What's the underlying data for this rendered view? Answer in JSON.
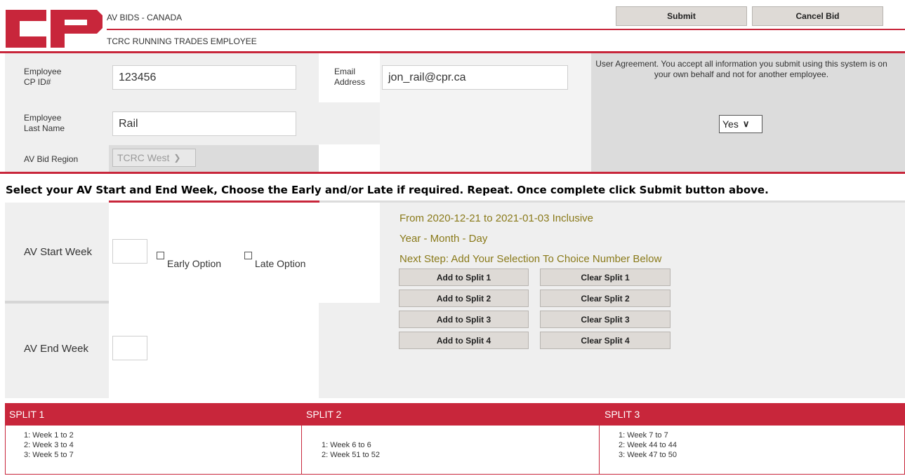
{
  "header": {
    "logo_text": "CP",
    "line1": "AV BIDS - CANADA",
    "line2": "TCRC RUNNING TRADES EMPLOYEE",
    "submit_label": "Submit",
    "cancel_label": "Cancel Bid"
  },
  "form": {
    "employee_id_label_1": "Employee",
    "employee_id_label_2": "CP ID#",
    "employee_id_value": "123456",
    "last_name_label_1": "Employee",
    "last_name_label_2": "Last Name",
    "last_name_value": "Rail",
    "region_label": "AV Bid Region",
    "region_value": "TCRC West",
    "email_label_1": "Email",
    "email_label_2": "Address",
    "email_value": "jon_rail@cpr.ca",
    "agreement_text": "User Agreement. You accept all information you submit using this system is on your own behalf and not for another employee.",
    "agreement_value": "Yes"
  },
  "instruction": "Select your AV Start and End Week, Choose the Early and/or Late if required. Repeat. Once complete click Submit button above.",
  "weeks": {
    "start_label": "AV Start Week",
    "end_label": "AV End Week",
    "early_label": "Early Option",
    "late_label": "Late Option",
    "start_value": "",
    "end_value": ""
  },
  "info": {
    "range": "From 2020-12-21 to 2021-01-03 Inclusive",
    "format": "Year - Month - Day",
    "next_step": "Next Step: Add Your Selection To Choice Number Below"
  },
  "split_buttons": {
    "add": [
      "Add to Split 1",
      "Add to Split 2",
      "Add to Split 3",
      "Add to Split 4"
    ],
    "clear": [
      "Clear Split 1",
      "Clear Split 2",
      "Clear Split 3",
      "Clear Split 4"
    ]
  },
  "splits": [
    {
      "title": "SPLIT 1",
      "lines": [
        "1: Week 1 to 2",
        "2: Week 3 to 4",
        "3: Week 5 to 7"
      ]
    },
    {
      "title": "SPLIT 2",
      "lines": [
        "1: Week 6 to 6",
        "2: Week 51 to 52"
      ]
    },
    {
      "title": "SPLIT 3",
      "lines": [
        "1: Week 7 to 7",
        "2: Week 44 to 44",
        "3: Week 47 to 50"
      ]
    }
  ],
  "colors": {
    "brand_red": "#c8263b",
    "gold_text": "#8a7a1a"
  }
}
